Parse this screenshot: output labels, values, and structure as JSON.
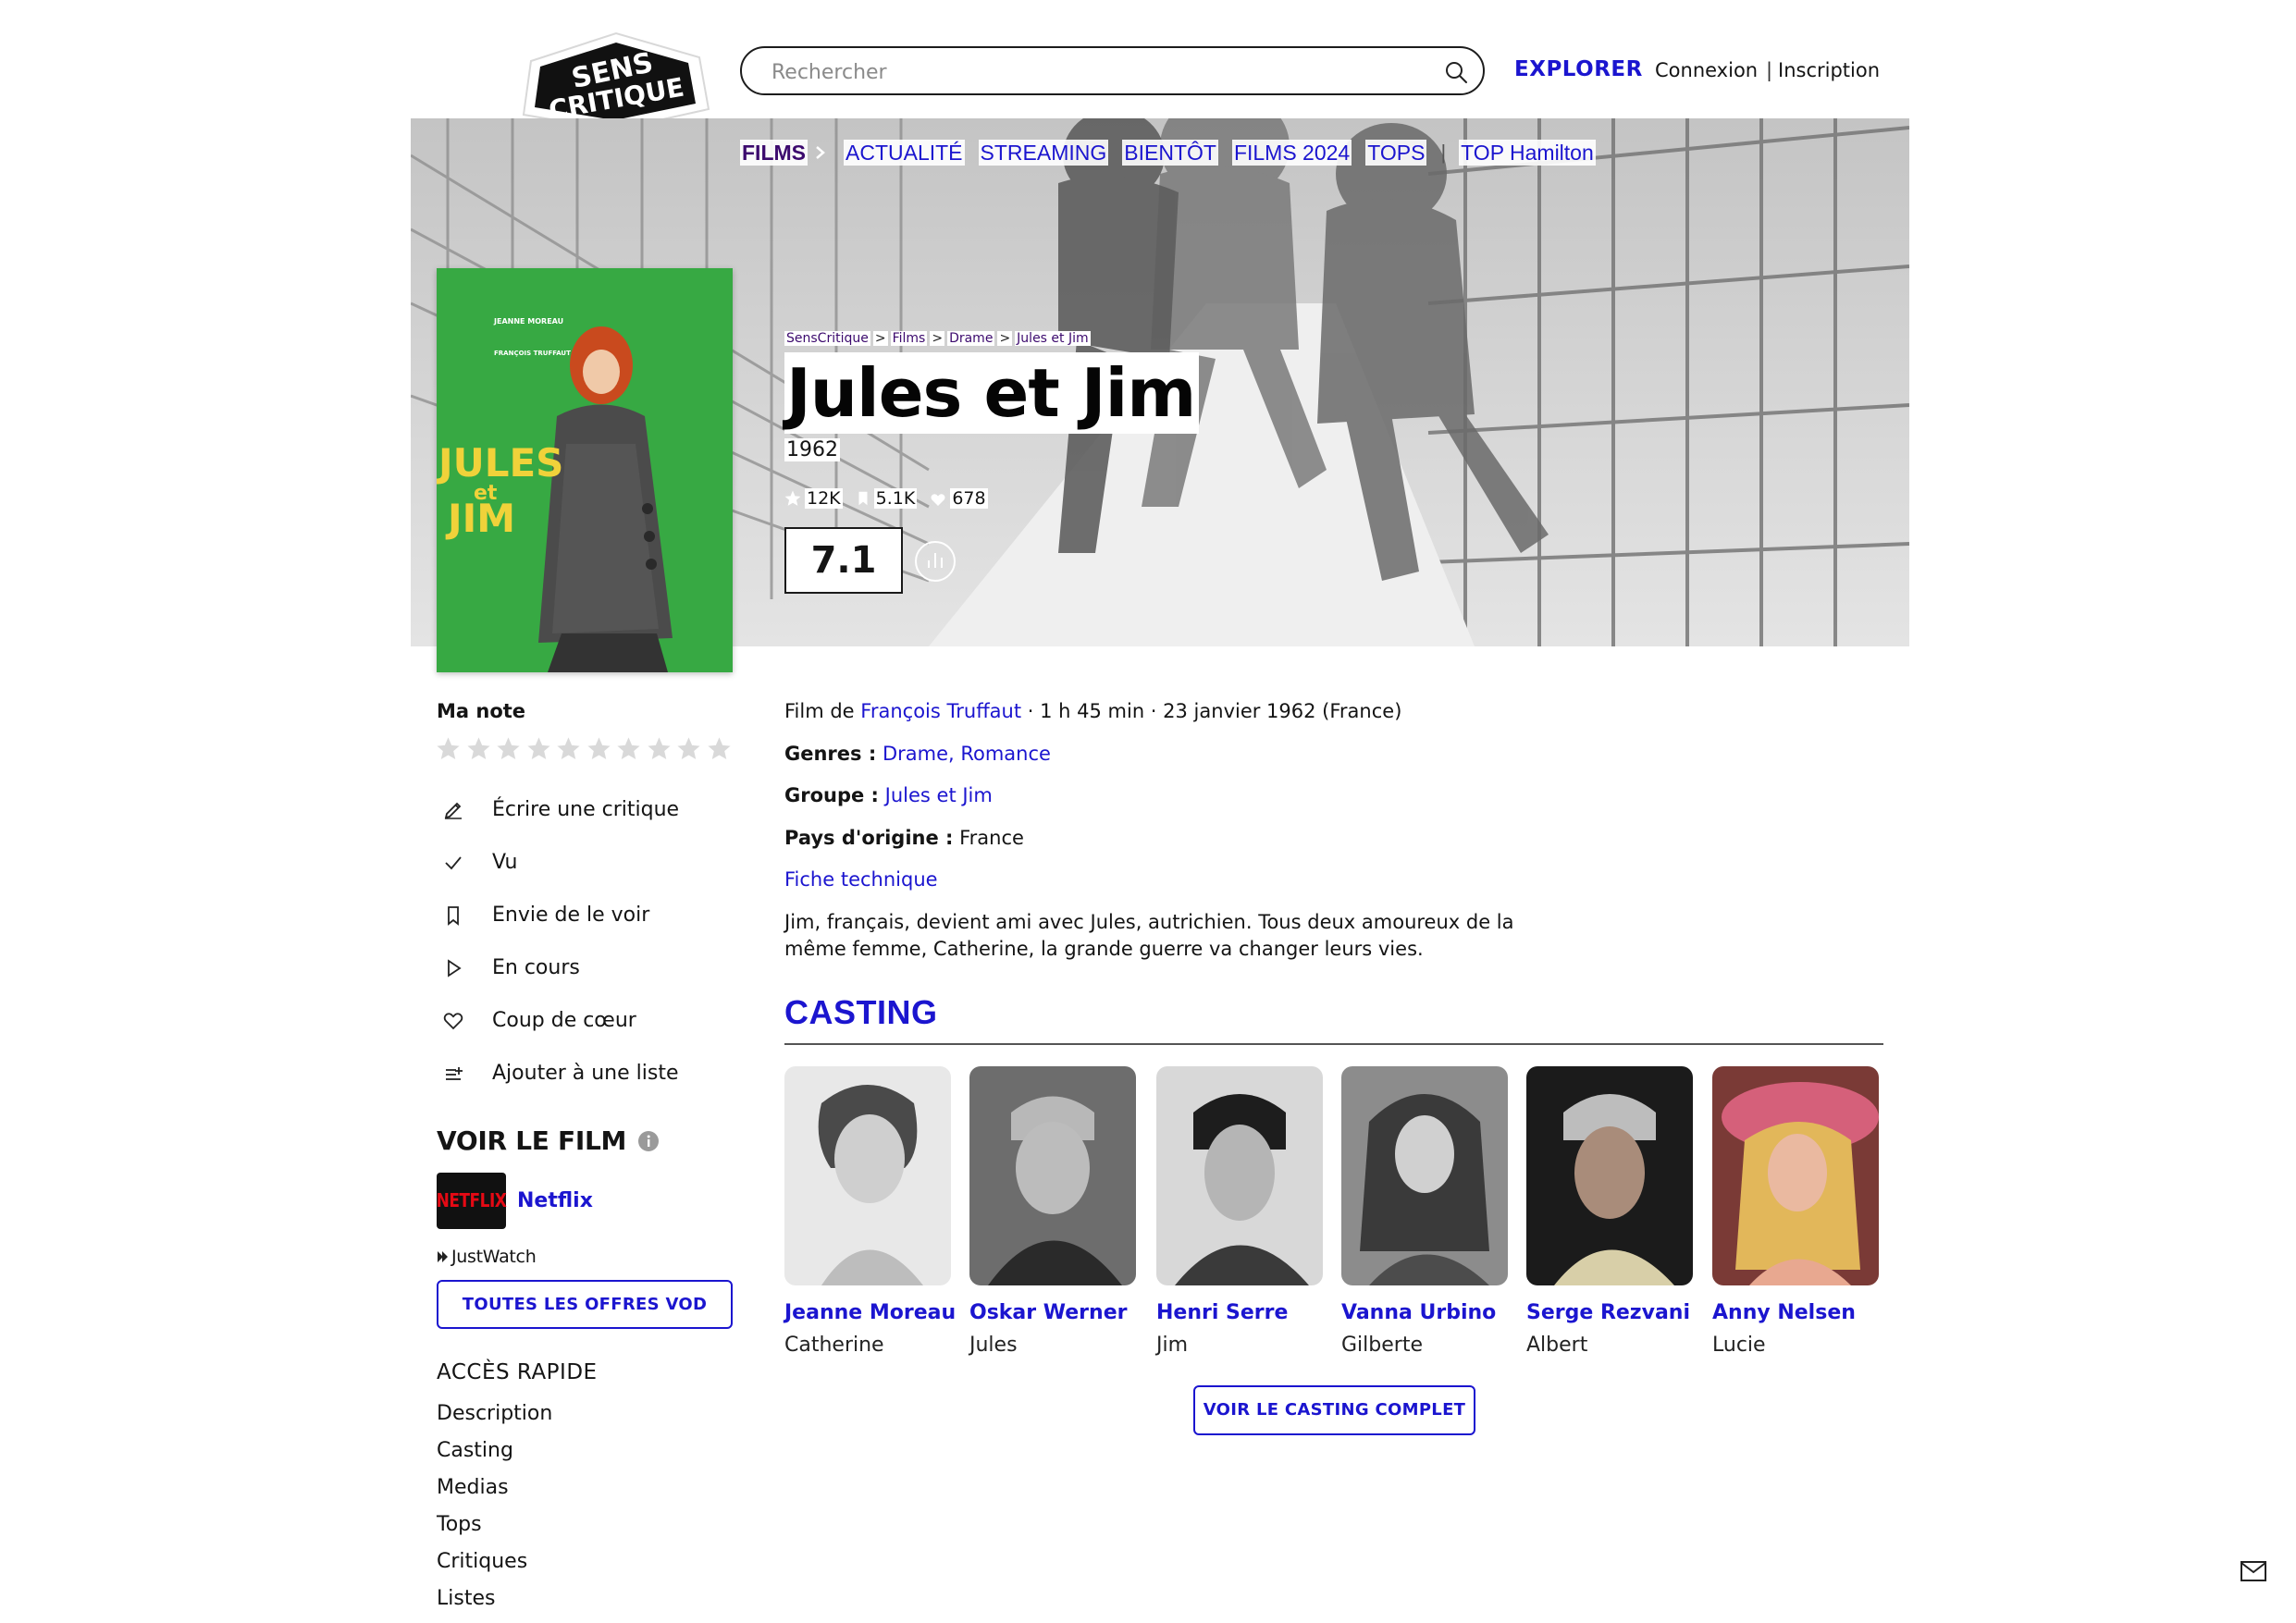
{
  "header": {
    "logo_text": "SENS CRITIQUE",
    "search_placeholder": "Rechercher",
    "explore": "EXPLORER",
    "login": "Connexion",
    "separator": "|",
    "signup": "Inscription"
  },
  "nav": {
    "items": [
      "FILMS",
      "ACTUALITÉ",
      "STREAMING",
      "BIENTÔT",
      "FILMS 2024",
      "TOPS",
      "TOP Hamilton"
    ]
  },
  "poster": {
    "texts": [
      "JEANNE MOREAU",
      "FRANÇOIS TRUFFAUT",
      "JULES",
      "et",
      "JIM"
    ]
  },
  "breadcrumb": [
    "SensCritique",
    "Films",
    "Drame",
    "Jules et Jim"
  ],
  "movie": {
    "title": "Jules et Jim",
    "year": "1962",
    "ratings_count": "12K",
    "wishlist_count": "5.1K",
    "favorites_count": "678",
    "score": "7.1",
    "director_prefix": "Film de",
    "director": "François Truffaut",
    "meta": "· 1 h 45 min · 23 janvier 1962 (France)",
    "genres_label": "Genres :",
    "genres": "Drame, Romance",
    "group_label": "Groupe :",
    "group": "Jules et Jim",
    "country_label": "Pays d'origine :",
    "country": "France",
    "technical_sheet": "Fiche technique",
    "synopsis": "Jim, français, devient ami avec Jules, autrichien. Tous deux amoureux de la même femme, Catherine, la grande guerre va changer leurs vies."
  },
  "sidebar": {
    "my_rating": "Ma note",
    "actions": [
      {
        "label": "Écrire une critique",
        "icon": "pencil-icon"
      },
      {
        "label": "Vu",
        "icon": "check-icon"
      },
      {
        "label": "Envie de le voir",
        "icon": "bookmark-icon"
      },
      {
        "label": "En cours",
        "icon": "play-icon"
      },
      {
        "label": "Coup de cœur",
        "icon": "heart-icon"
      },
      {
        "label": "Ajouter à une liste",
        "icon": "list-add-icon"
      }
    ],
    "watch_title": "VOIR LE FILM",
    "provider_logo": "NETFLIX",
    "provider": "Netflix",
    "justwatch": "JustWatch",
    "all_offers": "TOUTES LES OFFRES VOD",
    "quick_access_title": "ACCÈS RAPIDE",
    "quick_links": [
      "Description",
      "Casting",
      "Medias",
      "Tops",
      "Critiques",
      "Listes"
    ]
  },
  "casting": {
    "title": "CASTING",
    "actors": [
      {
        "name": "Jeanne Moreau",
        "role": "Catherine"
      },
      {
        "name": "Oskar Werner",
        "role": "Jules"
      },
      {
        "name": "Henri Serre",
        "role": "Jim"
      },
      {
        "name": "Vanna Urbino",
        "role": "Gilberte"
      },
      {
        "name": "Serge Rezvani",
        "role": "Albert"
      },
      {
        "name": "Anny Nelsen",
        "role": "Lucie"
      }
    ],
    "full_cast_button": "VOIR LE CASTING COMPLET"
  },
  "colors": {
    "accent": "#1b15cf",
    "films_nav": "#3c0a6e",
    "netflix_red": "#e50914"
  }
}
